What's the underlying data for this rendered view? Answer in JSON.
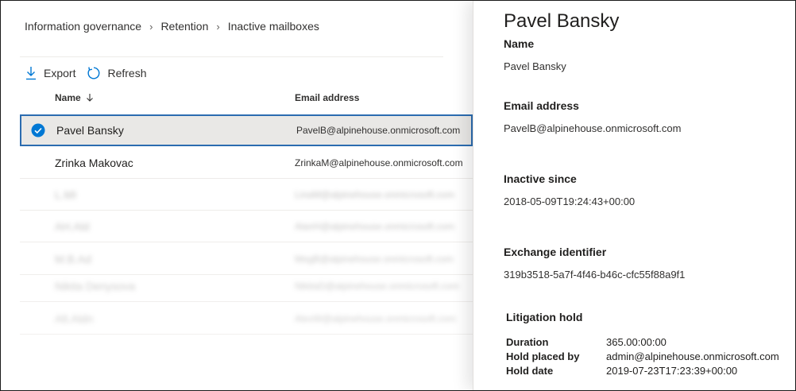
{
  "breadcrumb": {
    "items": [
      "Information governance",
      "Retention",
      "Inactive mailboxes"
    ]
  },
  "toolbar": {
    "export_label": "Export",
    "refresh_label": "Refresh"
  },
  "table": {
    "headers": {
      "name": "Name",
      "email": "Email address"
    },
    "sort": "descending",
    "rows": [
      {
        "name": "Pavel Bansky",
        "email": "PavelB@alpinehouse.onmicrosoft.com",
        "selected": true
      },
      {
        "name": "Zrinka Makovac",
        "email": "ZrinkaM@alpinehouse.onmicrosoft.com"
      },
      {
        "name": "L.MI",
        "email": "LinaM@alpinehouse.onmicrosoft.com"
      },
      {
        "name": "AH.Ald",
        "email": "AlanH@alpinehouse.onmicrosoft.com"
      },
      {
        "name": "M.B.Ad",
        "email": "MegB@alpinehouse.onmicrosoft.com"
      },
      {
        "name": "Nikita Denysova",
        "email": "NikitaD@alpinehouse.onmicrosoft.com"
      },
      {
        "name": "Alt.Aldn",
        "email": "AlexW@alpinehouse.onmicrosoft.com"
      }
    ]
  },
  "details": {
    "title": "Pavel Bansky",
    "name_label": "Name",
    "name_value": "Pavel Bansky",
    "email_label": "Email address",
    "email_value": "PavelB@alpinehouse.onmicrosoft.com",
    "inactive_label": "Inactive since",
    "inactive_value": "2018-05-09T19:24:43+00:00",
    "exchange_label": "Exchange identifier",
    "exchange_value": "319b3518-5a7f-4f46-b46c-cfc55f88a9f1",
    "litigation": {
      "title": "Litigation hold",
      "duration_label": "Duration",
      "duration_value": "365.00:00:00",
      "placed_by_label": "Hold placed by",
      "placed_by_value": "admin@alpinehouse.onmicrosoft.com",
      "date_label": "Hold date",
      "date_value": "2019-07-23T17:23:39+00:00"
    }
  },
  "colors": {
    "accent": "#0078d4",
    "selection_border": "#2b6cb0",
    "selection_bg": "#e9e8e6"
  },
  "icons": {
    "export": "download-icon",
    "refresh": "refresh-icon",
    "sort": "arrow-down-icon",
    "check": "check-circle-icon",
    "chevron": "chevron-right-icon"
  }
}
